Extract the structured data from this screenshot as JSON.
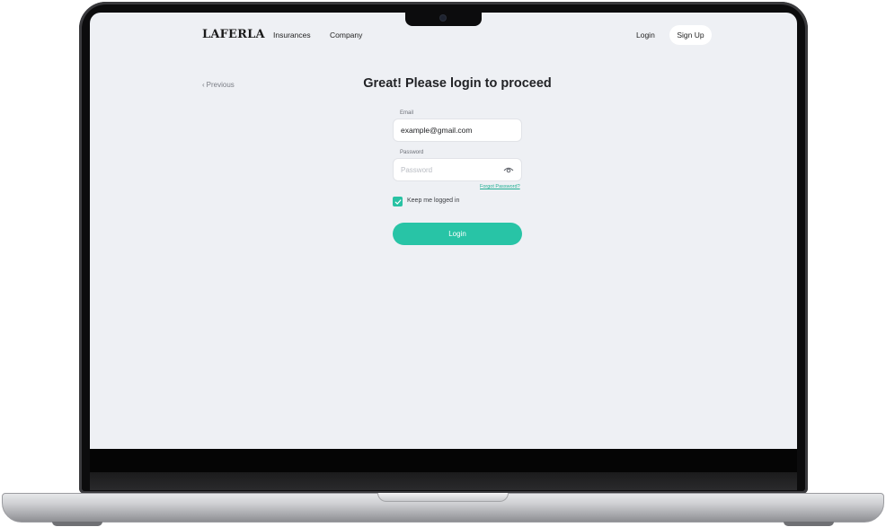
{
  "nav": {
    "logo": "LAFERLA",
    "links": [
      "Insurances",
      "Company"
    ],
    "login_label": "Login",
    "signup_label": "Sign Up"
  },
  "back": {
    "label": "Previous",
    "icon": "chevron-left-icon"
  },
  "form": {
    "title": "Great! Please login to proceed",
    "email_label": "Email",
    "email_value": "example@gmail.com",
    "password_label": "Password",
    "password_placeholder": "Password",
    "password_icon": "eye-icon",
    "forgot_label": "Forgot Password?",
    "keep_logged_in_label": "Keep me logged in",
    "keep_logged_in_checked": true,
    "submit_label": "Login"
  },
  "colors": {
    "accent": "#28c4a6",
    "screen_bg": "#eef0f4",
    "text": "#222326"
  }
}
